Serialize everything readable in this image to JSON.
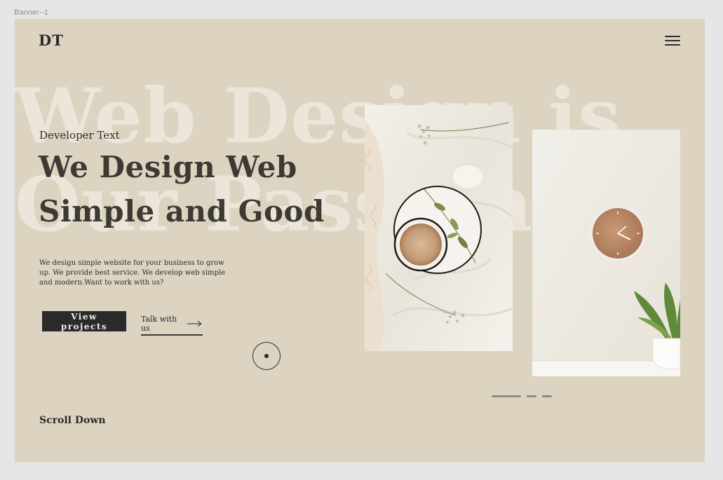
{
  "frame": {
    "label": "Banner--1"
  },
  "header": {
    "logo": "DT",
    "menu_icon": "hamburger-menu-icon"
  },
  "background_text": {
    "line1": "Web Design is",
    "line2": "Our Passion"
  },
  "hero": {
    "subtitle": "Developer Text",
    "headline_line1": "We Design Web",
    "headline_line2": "Simple and Good",
    "description": "We design simple website for your business to grow up. We provide best service. We develop web simple and modern.Want to work with us?",
    "primary_button": "View projects",
    "secondary_link": "Talk with us"
  },
  "footer": {
    "scroll_label": "Scroll Down"
  },
  "slider": {
    "active_index": 0,
    "count": 3
  },
  "colors": {
    "banner_bg": "#ddd3c1",
    "bg_text": "#ebe5da",
    "headline": "#3d3a34",
    "button_bg": "#2a2a2a"
  }
}
